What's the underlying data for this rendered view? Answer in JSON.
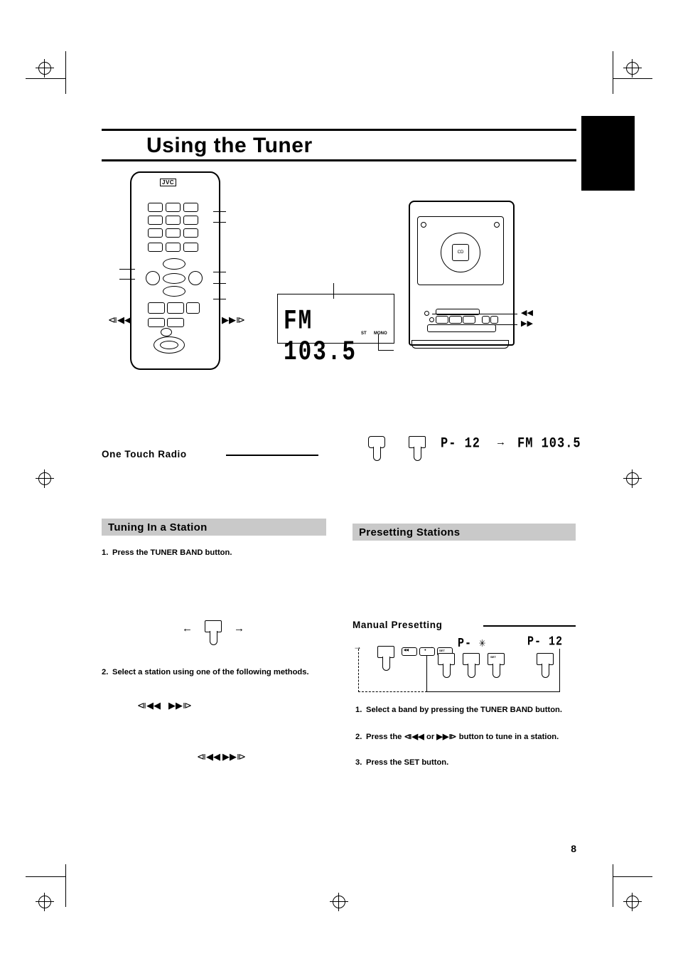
{
  "page": {
    "title": "Using the Tuner",
    "number": "8"
  },
  "remote": {
    "brand": "JVC",
    "rew_glyph": "⧏◀◀",
    "ff_glyph": "▶▶⧐",
    "btn_labels": [
      "",
      "",
      "",
      "",
      "",
      "",
      "",
      "",
      ""
    ]
  },
  "display": {
    "readout": "FM 103.5",
    "stereo_label": "ST",
    "mono_label": "MONO"
  },
  "unit": {
    "cd_label": "CD",
    "rew_glyph": "◀◀",
    "ff_glyph": "▶▶"
  },
  "one_touch": {
    "heading": "One Touch Radio",
    "preset_readout": "P- 12",
    "arrow": "→",
    "station_readout": "FM 103.5"
  },
  "tuning": {
    "heading": "Tuning In a Station",
    "step1_num": "1.",
    "step1_text": "Press the TUNER BAND button.",
    "step2_num": "2.",
    "step2_text": "Select a station using one of the following methods.",
    "arrow_left": "←",
    "arrow_right": "→",
    "rew_glyph": "⧏◀◀",
    "ff_glyph": "▶▶⧐",
    "rew_glyph2": "⧏◀◀",
    "ff_glyph2": "▶▶⧐"
  },
  "presetting": {
    "heading": "Presetting Stations",
    "manual_heading": "Manual Presetting",
    "flash_readout": "P- ✳",
    "preset_readout": "P- 12",
    "steps": [
      {
        "num": "1.",
        "text": "Select a band by pressing the TUNER BAND button."
      },
      {
        "num": "2.",
        "text": "Press the ⧏◀◀ or ▶▶⧐ button to tune in a station."
      },
      {
        "num": "3.",
        "text": "Press the SET button."
      }
    ],
    "btn_set": "SET",
    "btn_dot": "●",
    "btn_set2": "SET"
  },
  "colors": {
    "section_bar": "#c9c9c9",
    "ink": "#000000",
    "paper": "#ffffff"
  }
}
